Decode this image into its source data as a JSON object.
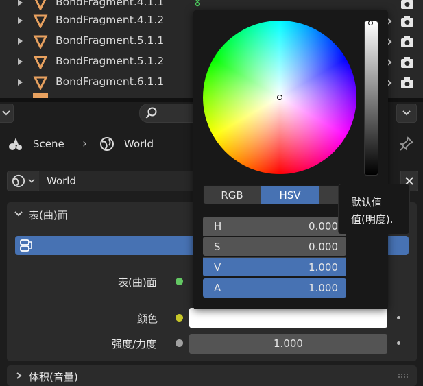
{
  "outliner": {
    "items": [
      {
        "label": "BondFragment.4.1.1"
      },
      {
        "label": "BondFragment.4.1.2"
      },
      {
        "label": "BondFragment.5.1.1"
      },
      {
        "label": "BondFragment.5.1.2"
      },
      {
        "label": "BondFragment.6.1.1"
      }
    ]
  },
  "breadcrumb": {
    "scene": "Scene",
    "separator": "›",
    "world": "World"
  },
  "world_selector": {
    "name": "World"
  },
  "surface_panel": {
    "header": "表(曲)面",
    "surface_label": "表(曲)面",
    "color_label": "颜色",
    "strength_label": "强度/力度",
    "strength_value": "1.000",
    "color_swatch": "#ffffff"
  },
  "volume_panel": {
    "header": "体积(音量)"
  },
  "color_picker": {
    "tabs": [
      "RGB",
      "HSV"
    ],
    "active_tab": "HSV",
    "fields": [
      {
        "key": "H",
        "value": "0.000"
      },
      {
        "key": "S",
        "value": "0.000"
      },
      {
        "key": "V",
        "value": "1.000"
      },
      {
        "key": "A",
        "value": "1.000"
      }
    ]
  },
  "tooltip": {
    "line1": "默认值",
    "line2": "值(明度)."
  },
  "colors": {
    "accent": "#4772b3",
    "panel": "#2b2b2b",
    "background": "#1d1d1d",
    "object_icon": "#e8a15f",
    "socket_green": "#63c763",
    "socket_yellow": "#c7c729",
    "socket_grey": "#a1a1a1"
  }
}
